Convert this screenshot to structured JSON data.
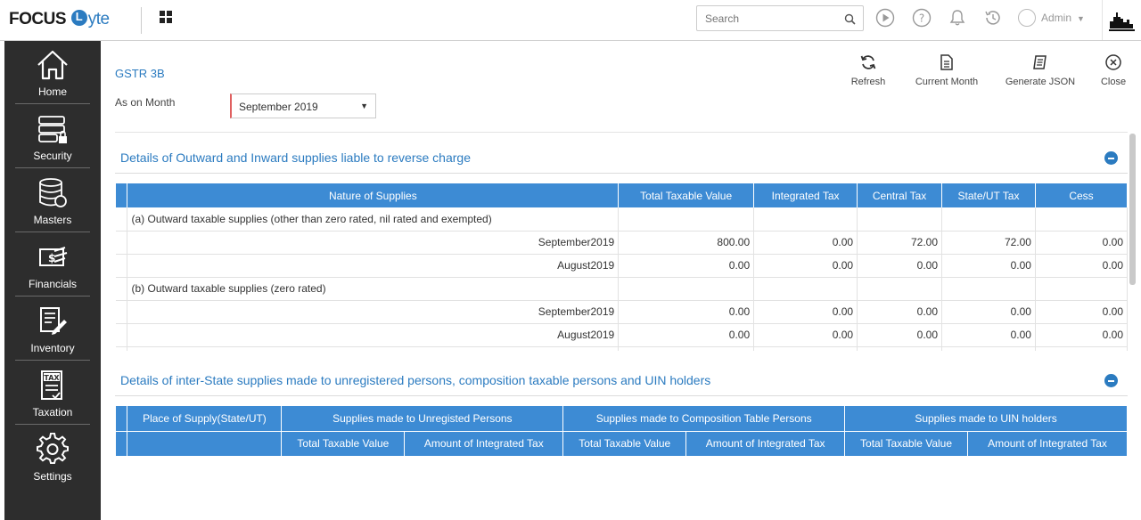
{
  "brand": {
    "focus": "FOCUS",
    "lyte": "yte"
  },
  "header": {
    "search_placeholder": "Search",
    "user": "Admin"
  },
  "sidebar": {
    "items": [
      {
        "label": "Home",
        "icon": "home-icon"
      },
      {
        "label": "Security",
        "icon": "security-icon"
      },
      {
        "label": "Masters",
        "icon": "masters-icon"
      },
      {
        "label": "Financials",
        "icon": "financials-icon"
      },
      {
        "label": "Inventory",
        "icon": "inventory-icon"
      },
      {
        "label": "Taxation",
        "icon": "taxation-icon"
      },
      {
        "label": "Settings",
        "icon": "settings-icon"
      }
    ]
  },
  "page": {
    "title": "GSTR 3B",
    "month_label": "As on Month",
    "month_value": "September 2019"
  },
  "actions": {
    "refresh": "Refresh",
    "current_month": "Current Month",
    "generate_json": "Generate JSON",
    "close": "Close"
  },
  "section1": {
    "title": "Details of Outward and Inward supplies liable to reverse charge",
    "columns": [
      "Nature of Supplies",
      "Total Taxable Value",
      "Integrated Tax",
      "Central Tax",
      "State/UT Tax",
      "Cess"
    ],
    "rows": [
      {
        "label": "(a) Outward taxable supplies (other than zero rated, nil rated and exempted)",
        "type": "cat",
        "values": [
          "",
          "",
          "",
          "",
          ""
        ]
      },
      {
        "label": "September2019",
        "type": "sub",
        "values": [
          "800.00",
          "0.00",
          "72.00",
          "72.00",
          "0.00"
        ]
      },
      {
        "label": "August2019",
        "type": "sub",
        "values": [
          "0.00",
          "0.00",
          "0.00",
          "0.00",
          "0.00"
        ]
      },
      {
        "label": "(b) Outward taxable supplies (zero rated)",
        "type": "cat",
        "values": [
          "",
          "",
          "",
          "",
          ""
        ]
      },
      {
        "label": "September2019",
        "type": "sub",
        "values": [
          "0.00",
          "0.00",
          "0.00",
          "0.00",
          "0.00"
        ]
      },
      {
        "label": "August2019",
        "type": "sub",
        "values": [
          "0.00",
          "0.00",
          "0.00",
          "0.00",
          "0.00"
        ]
      },
      {
        "label": "",
        "type": "sub",
        "values": [
          "",
          "",
          "",
          "",
          ""
        ]
      }
    ]
  },
  "section2": {
    "title": "Details of inter-State supplies made to unregistered persons, composition taxable persons and UIN holders",
    "group_headers": [
      "Place of Supply(State/UT)",
      "Supplies made to Unregisted Persons",
      "Supplies made to Composition Table Persons",
      "Supplies made to UIN holders"
    ],
    "sub_headers": [
      "Total Taxable Value",
      "Amount of Integrated Tax",
      "Total Taxable Value",
      "Amount of Integrated Tax",
      "Total Taxable Value",
      "Amount of Integrated Tax"
    ]
  }
}
